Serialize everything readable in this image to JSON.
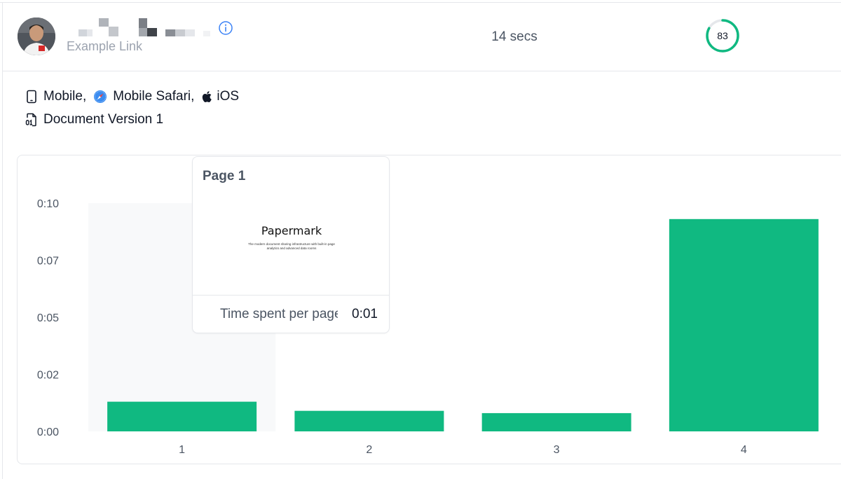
{
  "visitor": {
    "link_name": "Example Link",
    "duration": "14 secs",
    "completion": 83
  },
  "device": {
    "type": "Mobile,",
    "browser": "Mobile Safari,",
    "os": "iOS",
    "document_version": "Document Version 1"
  },
  "colors": {
    "accent": "#10b981",
    "hover_column": "#f8f9fa",
    "axis_text": "#4b5563"
  },
  "icons": {
    "device": "smartphone-icon",
    "browser": "safari-compass-icon",
    "os": "apple-icon",
    "document": "file-digit-icon",
    "info": "info-icon"
  },
  "tooltip": {
    "page_title": "Page 1",
    "preview_brand": "Papermark",
    "preview_tagline": "The modern document sharing infrastructure with built-in page analytics and advanced data rooms",
    "metric_label": "Time spent per page",
    "metric_value": "0:01"
  },
  "chart_data": {
    "type": "bar",
    "categories": [
      "1",
      "2",
      "3",
      "4"
    ],
    "values": [
      1.3,
      0.9,
      0.8,
      9.3
    ],
    "ylim": [
      0,
      10
    ],
    "yticks": [
      0,
      2.5,
      5,
      7.5,
      10
    ],
    "ytick_labels": [
      "0:00",
      "0:02",
      "0:05",
      "0:07",
      "0:10"
    ],
    "xlabel": "",
    "ylabel": "",
    "highlighted_category": "1"
  }
}
